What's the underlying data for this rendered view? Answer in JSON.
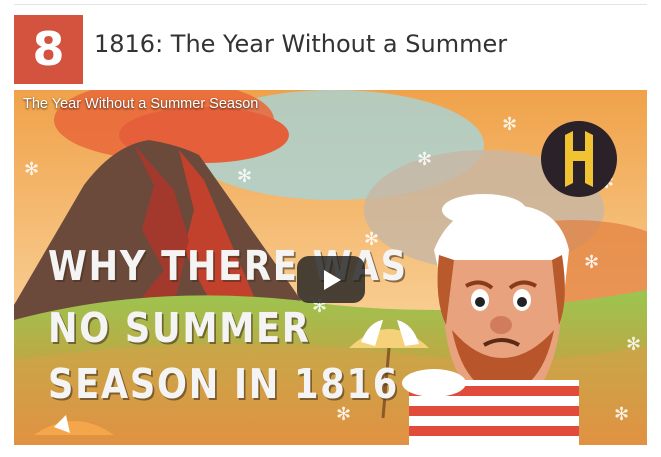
{
  "entry": {
    "rank": "8",
    "title": "1816: The Year Without a Summer"
  },
  "video": {
    "title": "The Year Without a Summer Season",
    "headline_lines": [
      "WHY THERE WAS",
      "NO SUMMER",
      "SEASON IN 1816"
    ],
    "channel_logo_icon": "history-h-logo-icon",
    "play_icon": "play-icon"
  },
  "colors": {
    "rank_background": "#d4533f",
    "title_text": "#333333",
    "logo_gold": "#f1c232"
  }
}
